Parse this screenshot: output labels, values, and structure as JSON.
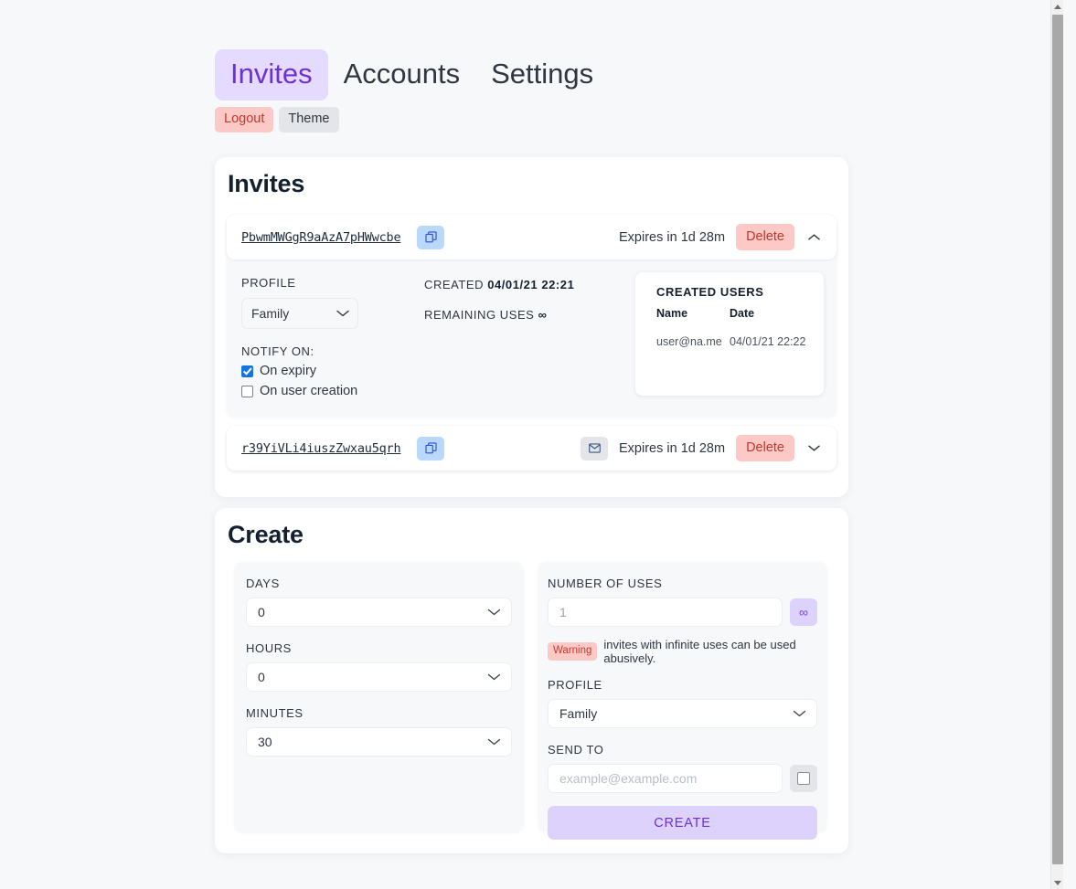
{
  "nav": {
    "tabs": [
      {
        "label": "Invites",
        "active": true
      },
      {
        "label": "Accounts",
        "active": false
      },
      {
        "label": "Settings",
        "active": false
      }
    ],
    "logout_label": "Logout",
    "theme_label": "Theme"
  },
  "invites_section": {
    "title": "Invites",
    "expires_label": "Expires in 1d 28m",
    "delete_label": "Delete",
    "items": [
      {
        "code": "PbwmMWGgR9aAzA7pHWwcbe",
        "expires": "Expires in 1d 28m",
        "delete": "Delete",
        "expanded": true,
        "has_mail_icon": false,
        "profile_label": "PROFILE",
        "profile_value": "Family",
        "created_label": "CREATED",
        "created_value": "04/01/21 22:21",
        "remaining_label": "REMAINING USES",
        "remaining_value": "∞",
        "notify_label": "NOTIFY ON:",
        "notify": [
          {
            "label": "On expiry",
            "checked": true
          },
          {
            "label": "On user creation",
            "checked": false
          }
        ],
        "created_users": {
          "title": "CREATED USERS",
          "columns": [
            "Name",
            "Date"
          ],
          "rows": [
            [
              "user@na.me",
              "04/01/21 22:22"
            ]
          ]
        }
      },
      {
        "code": "r39YiVLi4iuszZwxau5qrh",
        "expires": "Expires in 1d 28m",
        "delete": "Delete",
        "expanded": false,
        "has_mail_icon": true
      }
    ]
  },
  "create_section": {
    "title": "Create",
    "days_label": "DAYS",
    "days_value": "0",
    "hours_label": "HOURS",
    "hours_value": "0",
    "minutes_label": "MINUTES",
    "minutes_value": "30",
    "uses_label": "NUMBER OF USES",
    "uses_value": "1",
    "infinite_symbol": "∞",
    "warning_badge": "Warning",
    "warning_text": "invites with infinite uses can be used abusively.",
    "profile_label": "PROFILE",
    "profile_value": "Family",
    "send_to_label": "SEND TO",
    "send_to_placeholder": "example@example.com",
    "send_to_value": "",
    "create_label": "CREATE"
  },
  "colors": {
    "accent_purple": "#6f2fd8",
    "accent_purple_bg": "#ddd2fb",
    "danger_red": "#c0392b",
    "danger_bg": "#fcc9c6",
    "copy_blue_bg": "#b9d8fb",
    "page_bg": "#f7f8fa"
  }
}
